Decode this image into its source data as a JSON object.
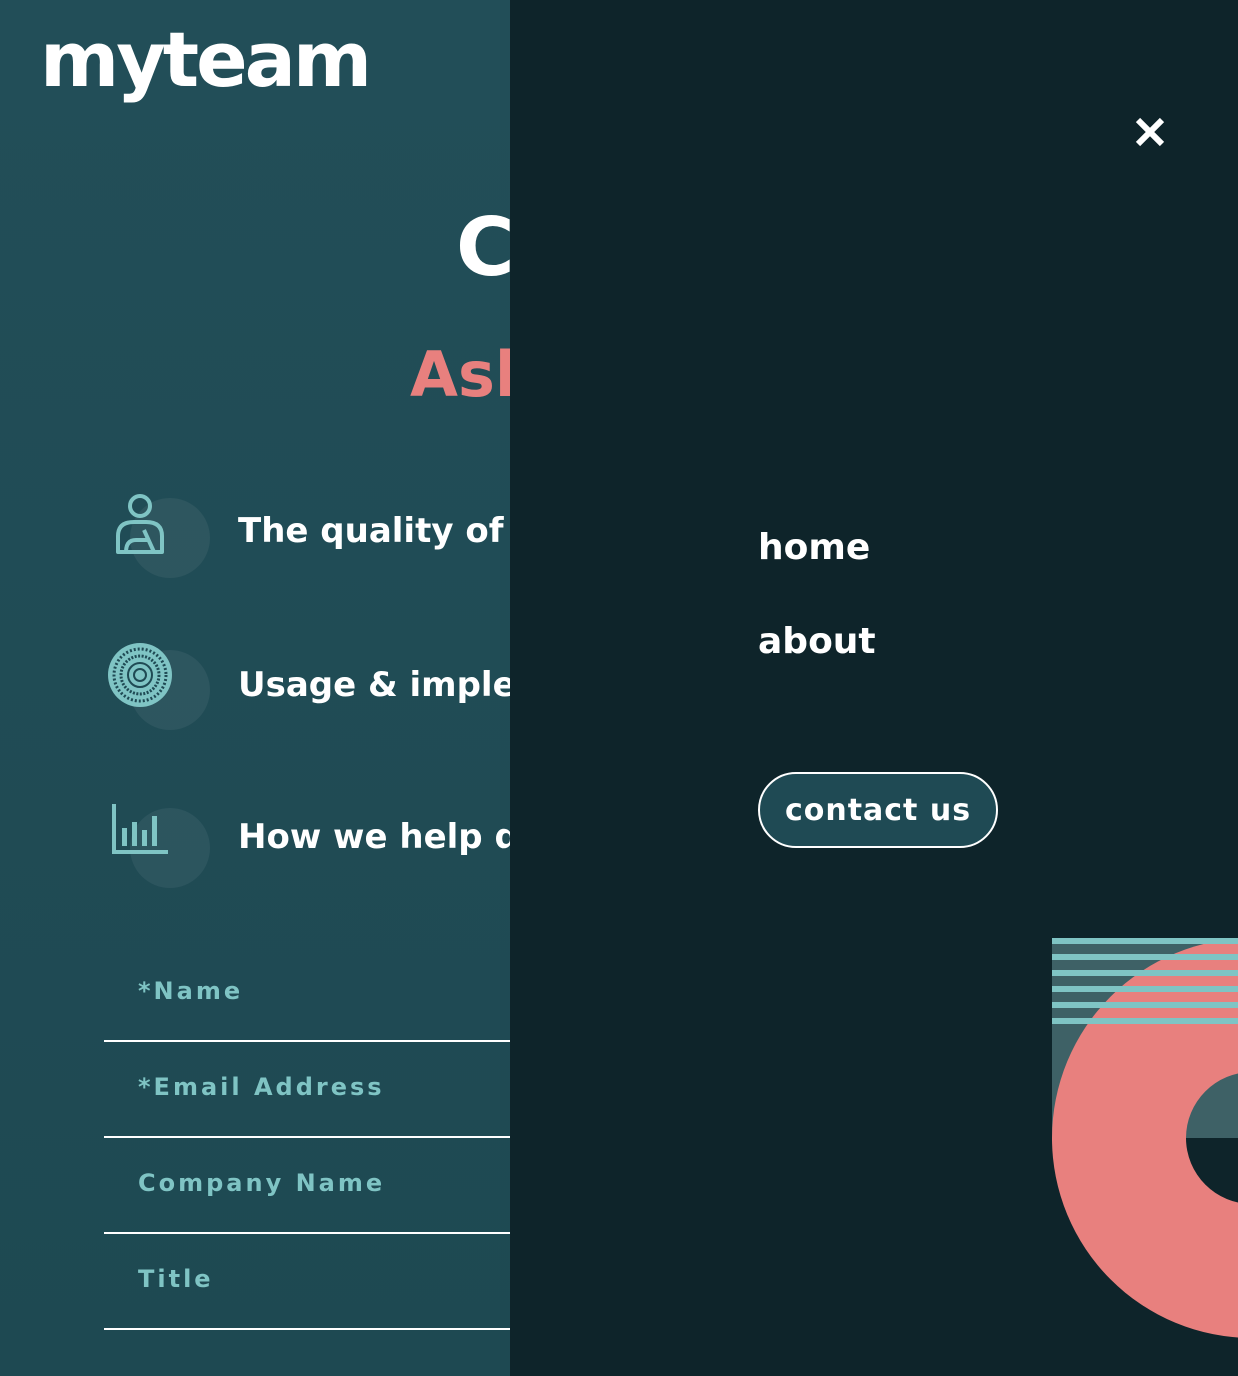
{
  "brand": {
    "logo_text": "myteam"
  },
  "hero": {
    "title": "C",
    "subtitle": "Ask"
  },
  "features": [
    {
      "icon": "person-icon",
      "text": "The quality of ou"
    },
    {
      "icon": "nexus-icon",
      "text": "Usage & implem"
    },
    {
      "icon": "chart-icon",
      "text": "How we help dri"
    }
  ],
  "form": {
    "name_placeholder": "*Name",
    "email_placeholder": "*Email Address",
    "company_placeholder": "Company Name",
    "title_placeholder": "Title"
  },
  "menu": {
    "close_icon": "close-icon",
    "links": [
      "home",
      "about"
    ],
    "cta_label": "contact us"
  },
  "colors": {
    "page_bg": "#1f4a54",
    "menu_bg": "#0e242a",
    "accent_coral": "#e8807e",
    "accent_teal": "#7fc4c4",
    "text": "#ffffff"
  }
}
